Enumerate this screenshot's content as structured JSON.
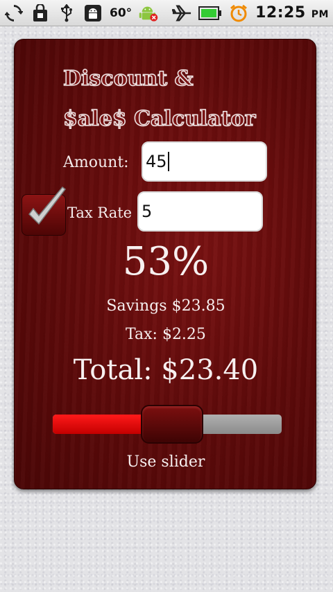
{
  "status_bar": {
    "temperature": "60°",
    "time": "12:25",
    "ampm": "PM",
    "icons": [
      "sync-icon",
      "shopping-bag-icon",
      "usb-icon",
      "android-debug-icon",
      "android-notification-icon",
      "airplane-mode-icon",
      "battery-icon",
      "alarm-clock-icon"
    ]
  },
  "app": {
    "title_line1": "Discount &",
    "title_line2": "$ale$ Calculator",
    "amount_label": "Amount:",
    "amount_value": "45",
    "tax_label": "Tax Rate",
    "tax_value": "5",
    "tax_checked": true,
    "discount_percent": "53%",
    "savings": "Savings $23.85",
    "tax": "Tax: $2.25",
    "total": "Total: $23.40",
    "slider_label": "Use slider",
    "slider_value": 0.53
  },
  "colors": {
    "card": "#6b0e0e",
    "slider_fill": "#e00000",
    "slider_track": "#9a9a9a",
    "battery": "#33cc33",
    "alarm": "#f08a00"
  }
}
